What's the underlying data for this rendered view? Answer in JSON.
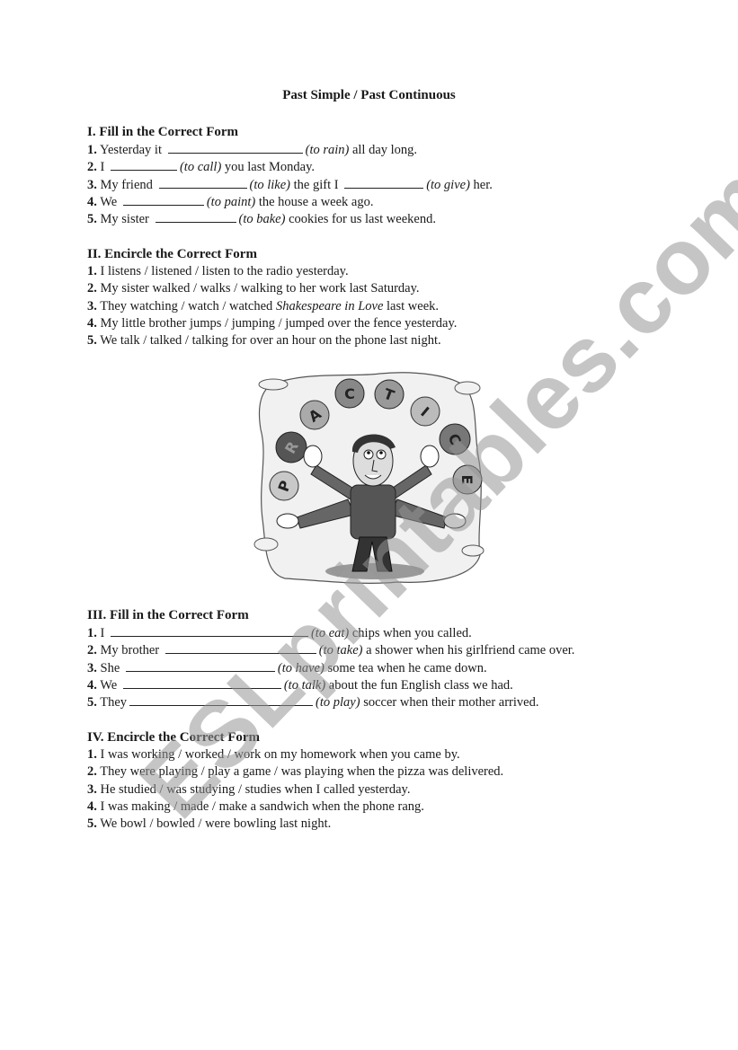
{
  "title": "Past Simple / Past Continuous",
  "watermark": "ESLprintables.com",
  "illustration": {
    "description": "cartoon man with four arms juggling letter balls",
    "letters": [
      "P",
      "R",
      "A",
      "C",
      "T",
      "I",
      "C",
      "E"
    ]
  },
  "sections": [
    {
      "heading": "I. Fill in the Correct Form",
      "items": [
        {
          "num": "1.",
          "before": "Yesterday it",
          "hint": "(to rain)",
          "after": "all day long."
        },
        {
          "num": "2.",
          "before": "I",
          "hint": "(to call)",
          "after": "you last Monday."
        },
        {
          "num": "3.",
          "before": "My friend",
          "hint": "(to like)",
          "after": "the gift I",
          "hint2": "(to give)",
          "after2": "her."
        },
        {
          "num": "4.",
          "before": "We",
          "hint": "(to paint)",
          "after": "the house a week ago."
        },
        {
          "num": "5.",
          "before": "My sister",
          "hint": "(to bake)",
          "after": "cookies for us last weekend."
        }
      ]
    },
    {
      "heading": "II. Encircle the Correct Form",
      "items": [
        {
          "num": "1.",
          "text": "I listens / listened / listen to the radio yesterday."
        },
        {
          "num": "2.",
          "text": "My sister walked / walks / walking to her work last Saturday."
        },
        {
          "num": "3.",
          "text": "They watching / watch / watched",
          "italic": "Shakespeare in Love",
          "after": "last week."
        },
        {
          "num": "4.",
          "text": " My little brother jumps / jumping / jumped over the fence yesterday."
        },
        {
          "num": "5.",
          "text": "We talk / talked / talking for over an hour on the phone last night."
        }
      ]
    },
    {
      "heading": "III. Fill in the Correct Form",
      "items": [
        {
          "num": "1.",
          "before": " I",
          "hint": "(to eat)",
          "after": "chips when you called."
        },
        {
          "num": "2.",
          "before": "My brother",
          "hint": "(to take)",
          "after": "a shower when his girlfriend came over."
        },
        {
          "num": "3.",
          "before": "She",
          "hint": "(to have)",
          "after": "some tea when he came down."
        },
        {
          "num": "4.",
          "before": "We",
          "hint": "(to talk)",
          "after": "about the fun English class we had."
        },
        {
          "num": "5.",
          "before": "They",
          "hint": "(to play)",
          "after": "soccer when their mother arrived."
        }
      ]
    },
    {
      "heading": "IV. Encircle the Correct Form",
      "items": [
        {
          "num": "1.",
          "text": "I was working / worked / work on my homework when you came by."
        },
        {
          "num": "2.",
          "text": "They were playing / play a game / was playing when the pizza was delivered."
        },
        {
          "num": "3.",
          "text": "He studied / was studying / studies when I called yesterday."
        },
        {
          "num": "4.",
          "text": "I was making / made / make a sandwich when the phone rang."
        },
        {
          "num": "5.",
          "text": "We bowl / bowled / were bowling last night."
        }
      ]
    }
  ]
}
